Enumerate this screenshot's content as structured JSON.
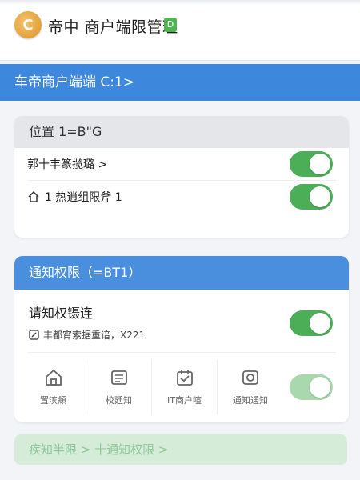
{
  "header": {
    "logo_letter": "C",
    "title": "帝中 商户端限管理",
    "badge": "D"
  },
  "banner": {
    "label": "车帝商户端端 C:1>"
  },
  "location_card": {
    "header": "位置 1=B\"G",
    "rows": [
      {
        "label": "郭十丰篆揽璐 >"
      },
      {
        "label": "1 热逍组限斧 1"
      }
    ]
  },
  "notify_card": {
    "header": "通知权限（=BT1）",
    "title": "请知权镊连",
    "desc": "丰都宵索据重谙，X221",
    "icons": [
      {
        "icon": "home-icon",
        "label": "置滨頫"
      },
      {
        "icon": "document-icon",
        "label": "校廷知"
      },
      {
        "icon": "calendar-icon",
        "label": "IT商户喧"
      },
      {
        "icon": "camera-icon",
        "label": "通知通知"
      }
    ]
  },
  "bottom_button": {
    "label": "疾知半限 > 十通知权限 >"
  },
  "colors": {
    "banner_blue": "#3d87dc",
    "toggle_green": "#4caf58",
    "toggle_faded": "#a9d8ae"
  }
}
